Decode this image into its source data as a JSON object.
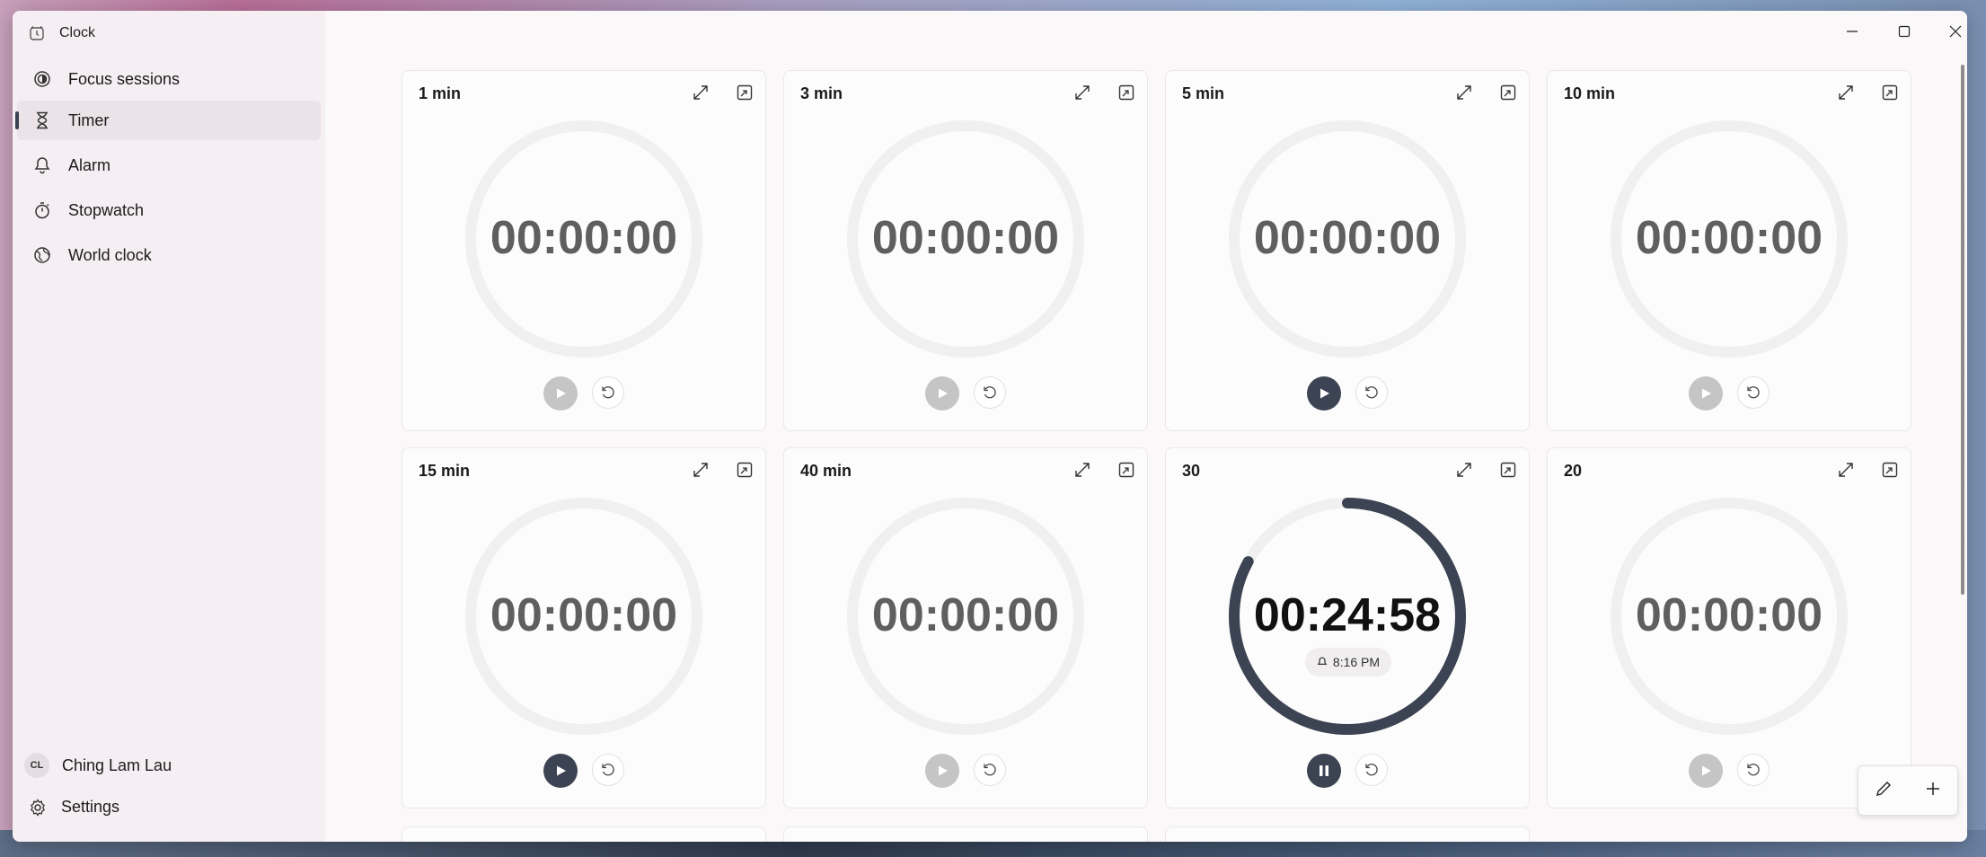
{
  "app": {
    "title": "Clock"
  },
  "nav": [
    {
      "label": "Focus sessions",
      "icon": "focus-icon"
    },
    {
      "label": "Timer",
      "icon": "hourglass-icon",
      "active": true
    },
    {
      "label": "Alarm",
      "icon": "bell-icon"
    },
    {
      "label": "Stopwatch",
      "icon": "stopwatch-icon"
    },
    {
      "label": "World clock",
      "icon": "globe-icon"
    }
  ],
  "profile": {
    "initials": "CL",
    "name": "Ching Lam Lau"
  },
  "settings": {
    "label": "Settings"
  },
  "timers": [
    {
      "title": "1 min",
      "time": "00:00:00",
      "state": "idle-disabled"
    },
    {
      "title": "3 min",
      "time": "00:00:00",
      "state": "idle-disabled"
    },
    {
      "title": "5 min",
      "time": "00:00:00",
      "state": "idle-enabled"
    },
    {
      "title": "10 min",
      "time": "00:00:00",
      "state": "idle-disabled"
    },
    {
      "title": "15 min",
      "time": "00:00:00",
      "state": "idle-enabled"
    },
    {
      "title": "40 min",
      "time": "00:00:00",
      "state": "idle-disabled"
    },
    {
      "title": "30",
      "time": "00:24:58",
      "state": "running",
      "alarm_time": "8:16 PM",
      "progress": 0.83
    },
    {
      "title": "20",
      "time": "00:00:00",
      "state": "idle-disabled"
    }
  ],
  "colors": {
    "accent": "#3c4352",
    "ring_track": "#f0f0f0",
    "disabled": "#c5c5c5"
  }
}
